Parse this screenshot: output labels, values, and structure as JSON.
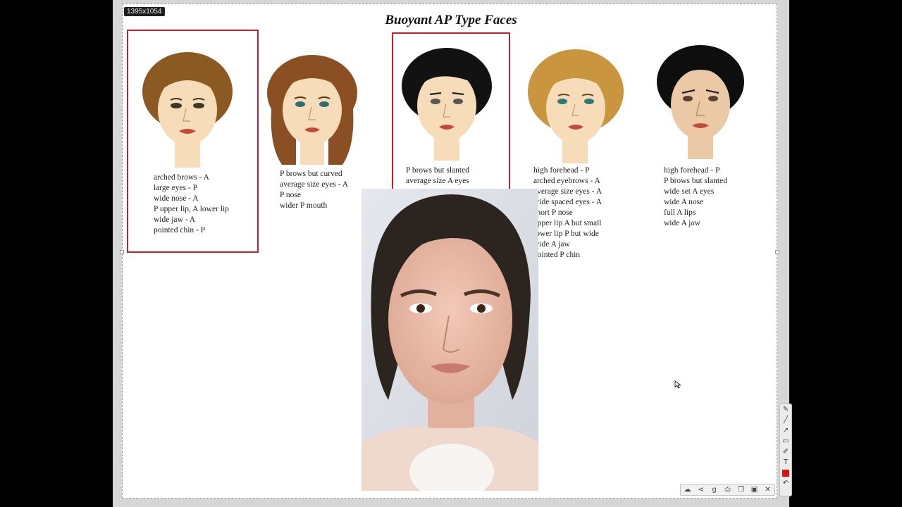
{
  "canvas": {
    "dimensions": "1395x1054"
  },
  "slide": {
    "title": "Buoyant  AP Type Faces",
    "faces": [
      {
        "hair": "#8a5a22",
        "lines": [
          "arched brows - A",
          "large eyes - P",
          "wide nose - A",
          "P upper lip, A lower lip",
          "wide jaw - A",
          "pointed  chin - P"
        ]
      },
      {
        "hair": "#8b4f24",
        "lines": [
          "P brows but curved",
          "average size eyes - A",
          "P nose",
          "wider P mouth"
        ]
      },
      {
        "hair": "#121212",
        "lines": [
          "P brows but slanted",
          "average size A eyes"
        ]
      },
      {
        "hair": "#c9963f",
        "lines": [
          "high forehead - P",
          "arched eyebrows - A",
          "average size eyes - A",
          "wide spaced eyes - A",
          "short P nose",
          "upper lip A but small",
          "lower lip P but wide",
          "wide A jaw",
          "pointed P chin"
        ]
      },
      {
        "hair": "#0e0e0e",
        "lines": [
          "high forehead - P",
          "P brows but slanted",
          "wide set A eyes",
          "wide A nose",
          "full A lips",
          "wide A jaw"
        ]
      }
    ]
  },
  "colors": {
    "highlight_box": "#cc1f2a",
    "skin": "#f6dcb8"
  },
  "toolbar_vertical": [
    "pencil-icon",
    "line-icon",
    "arrow-icon",
    "rectangle-icon",
    "highlighter-icon",
    "text-icon",
    "color-swatch",
    "undo-icon"
  ],
  "toolbar_horizontal": [
    "cloud-upload-icon",
    "share-icon",
    "google-icon",
    "print-icon",
    "copy-icon",
    "save-icon",
    "close-icon"
  ]
}
